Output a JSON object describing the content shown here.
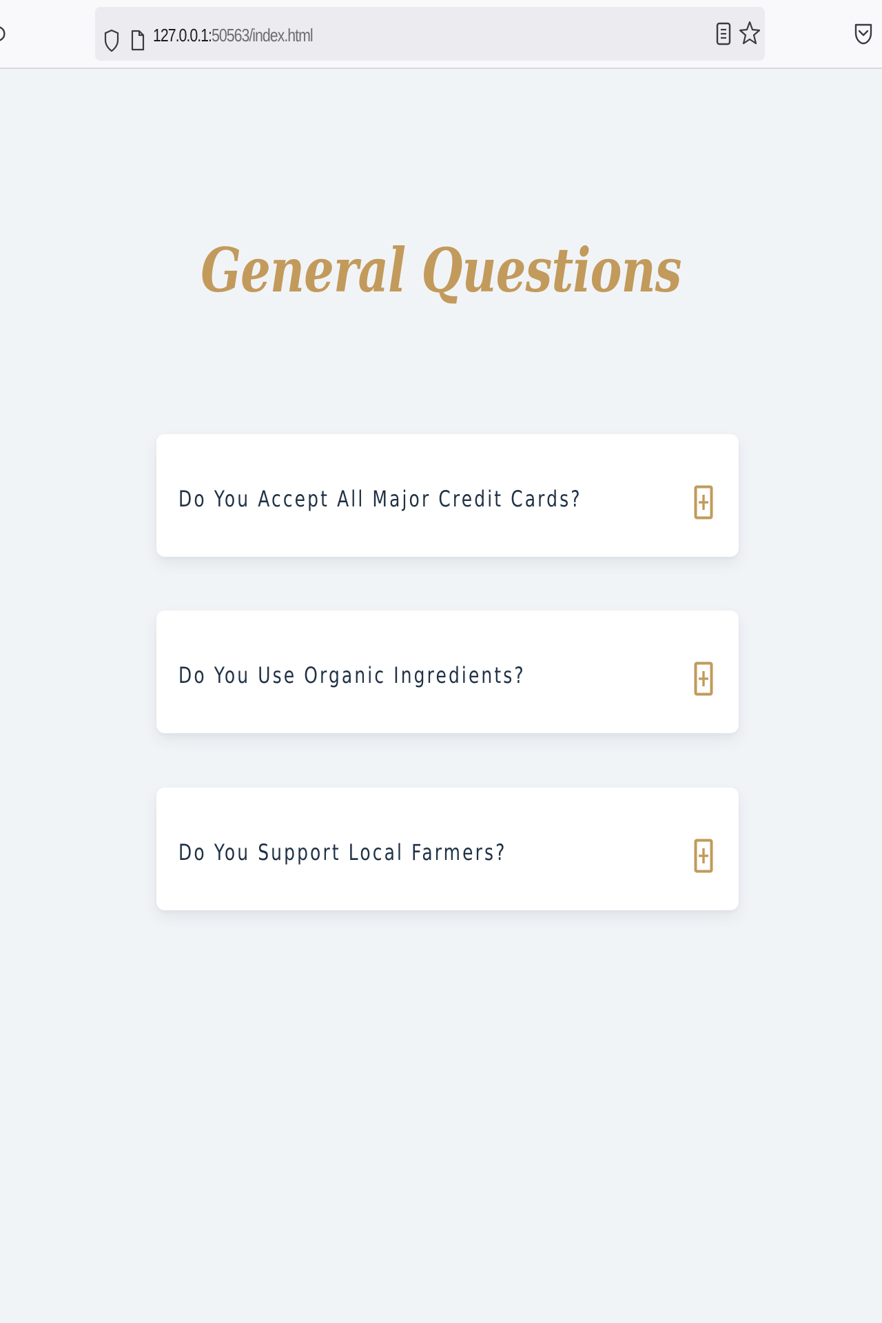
{
  "browser": {
    "url_host": "127.0.0.1:",
    "url_path": "50563/index.html"
  },
  "icons": {
    "reload": "reload-icon",
    "tracking_protection": "shield-icon",
    "page_info": "page-icon",
    "reader_view": "reader-view-icon",
    "bookmark": "star-icon",
    "pocket": "pocket-icon",
    "expand": "plus-square-icon"
  },
  "colors": {
    "accent": "#c29a5b",
    "question_text": "#1f3145",
    "page_background": "#f1f4f7",
    "card_background": "#ffffff"
  },
  "page": {
    "title": "General Questions"
  },
  "faq": {
    "items": [
      {
        "question": "Do You Accept All Major Credit Cards?"
      },
      {
        "question": "Do You Use Organic Ingredients?"
      },
      {
        "question": "Do You Support Local Farmers?"
      }
    ]
  }
}
